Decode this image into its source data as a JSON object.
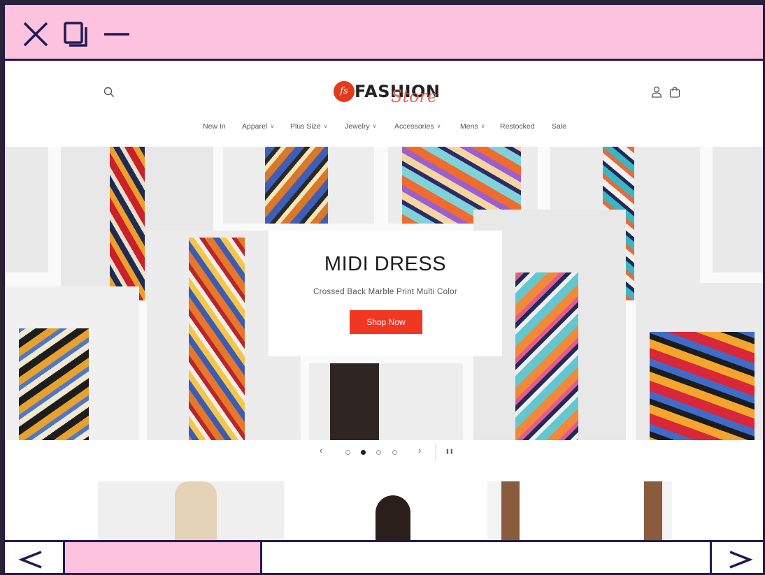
{
  "window": {
    "controls": [
      "close-icon",
      "maximize-icon",
      "minimize-icon"
    ],
    "accent": "#fdc2de",
    "border": "#231a52"
  },
  "store": {
    "logo_mark": "fs",
    "logo_word": "FASHION",
    "logo_script": "Store",
    "brand_color": "#e5391c"
  },
  "header_icons": [
    "search-icon",
    "account-icon",
    "cart-icon"
  ],
  "nav": {
    "items": [
      {
        "label": "New In",
        "dropdown": false
      },
      {
        "label": "Apparel",
        "dropdown": true
      },
      {
        "label": "Plus Size",
        "dropdown": true
      },
      {
        "label": "Jewelry",
        "dropdown": true
      },
      {
        "label": "Accessories",
        "dropdown": true
      },
      {
        "label": "Mens",
        "dropdown": true
      },
      {
        "label": "Restocked",
        "dropdown": false
      },
      {
        "label": "Sale",
        "dropdown": false
      }
    ]
  },
  "hero": {
    "title": "MIDI DRESS",
    "subtitle": "Crossed Back Marble Print Multi Color",
    "cta": "Shop Now",
    "cta_color": "#ef3722"
  },
  "slideshow": {
    "prev_icon": "‹",
    "next_icon": "›",
    "pause_icon": "❚❚",
    "slide_count": 4,
    "active_index": 1
  },
  "browser_nav": {
    "back_icon": "<",
    "forward_icon": ">"
  }
}
